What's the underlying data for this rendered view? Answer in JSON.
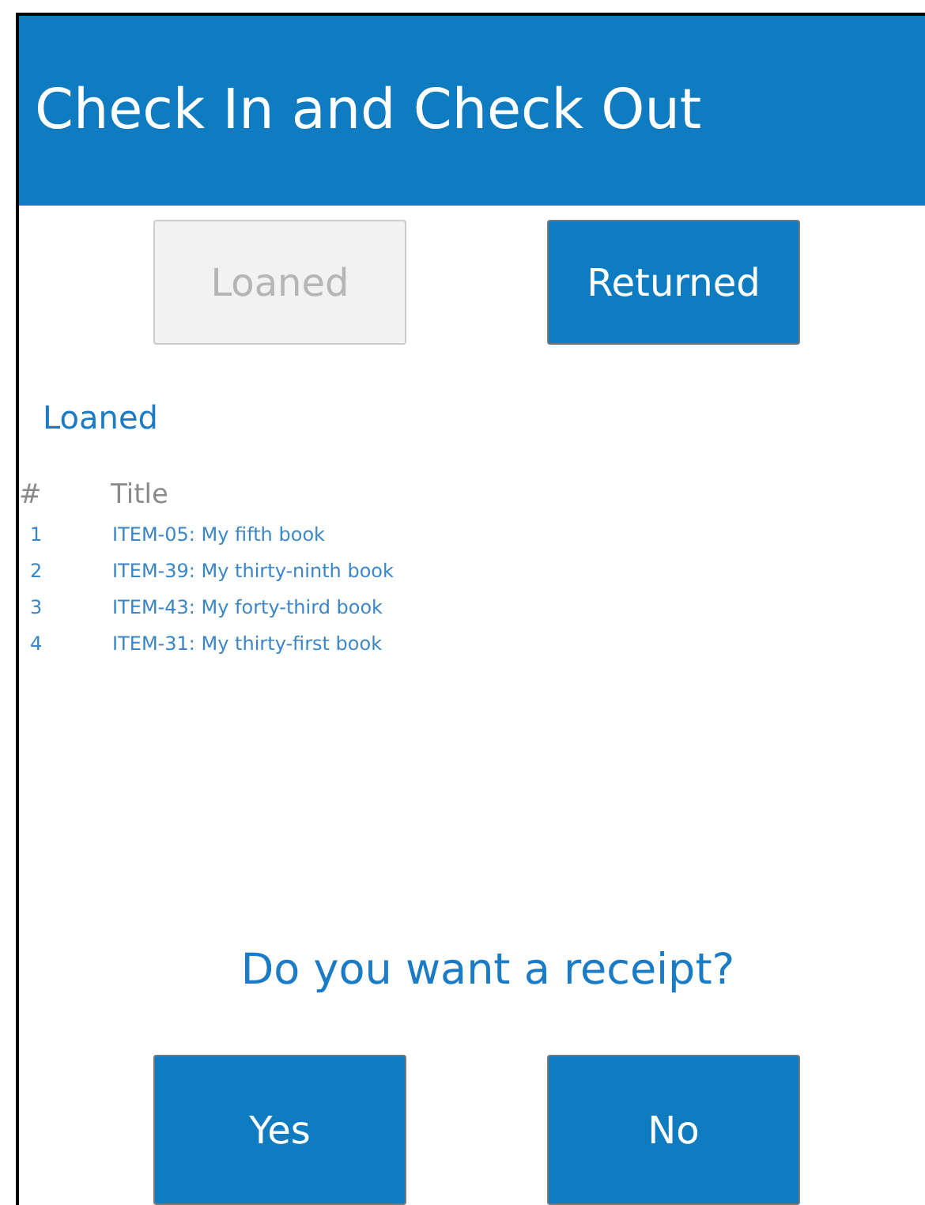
{
  "header": {
    "title": "Check In and Check Out"
  },
  "toggles": [
    {
      "label": "Loaned",
      "selected": false
    },
    {
      "label": "Returned",
      "selected": true
    }
  ],
  "section": {
    "title": "Loaned"
  },
  "table": {
    "columns": [
      "#",
      "Title"
    ],
    "rows": [
      [
        "1",
        "ITEM-05: My fifth book"
      ],
      [
        "2",
        "ITEM-39: My thirty-ninth book"
      ],
      [
        "3",
        "ITEM-43: My forty-third book"
      ],
      [
        "4",
        "ITEM-31: My thirty-first book"
      ]
    ]
  },
  "question": "Do you want a receipt?",
  "answers": [
    "Yes",
    "No"
  ]
}
